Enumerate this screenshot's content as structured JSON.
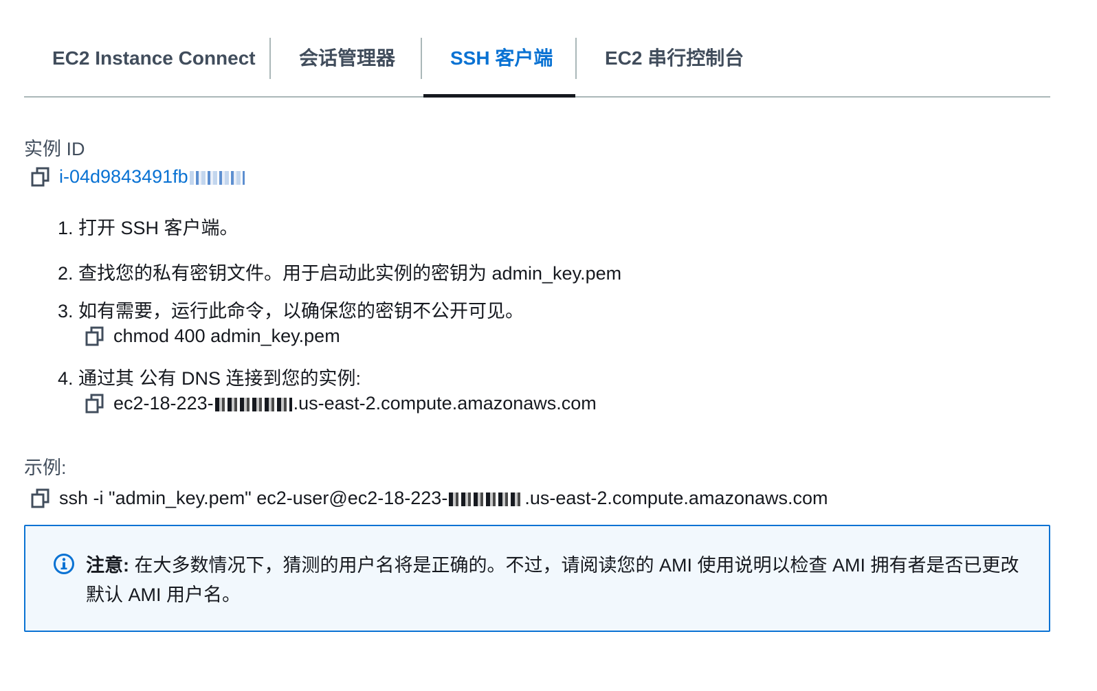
{
  "tabs": [
    {
      "label": "EC2 Instance Connect",
      "active": false
    },
    {
      "label": "会话管理器",
      "active": false
    },
    {
      "label": "SSH 客户端",
      "active": true
    },
    {
      "label": "EC2 串行控制台",
      "active": false
    }
  ],
  "instance": {
    "label": "实例 ID",
    "id_visible": "i-04d9843491fb"
  },
  "steps": [
    {
      "num": "1.",
      "text": "打开 SSH 客户端。"
    },
    {
      "num": "2.",
      "text": "查找您的私有密钥文件。用于启动此实例的密钥为 admin_key.pem"
    },
    {
      "num": "3.",
      "text": "如有需要，运行此命令，以确保您的密钥不公开可见。"
    },
    {
      "num": "4.",
      "text": "通过其 公有 DNS 连接到您的实例:"
    }
  ],
  "commands": {
    "chmod": "chmod 400 admin_key.pem",
    "dns_prefix": "ec2-18-223-",
    "dns_suffix": ".us-east-2.compute.amazonaws.com"
  },
  "example": {
    "label": "示例:",
    "prefix": "ssh -i \"admin_key.pem\" ec2-user@ec2-18-223-",
    "suffix": ".us-east-2.compute.amazonaws.com"
  },
  "notice": {
    "title": "注意:",
    "body": " 在大多数情况下，猜测的用户名将是正确的。不过，请阅读您的 AMI 使用说明以检查 AMI 拥有者是否已更改默认 AMI 用户名。"
  },
  "colors": {
    "accent": "#0972d3",
    "text": "#16191f",
    "muted": "#414d5c",
    "notice_bg": "#f2f8fd"
  },
  "icons": {
    "copy": "copy-icon",
    "info": "info-icon"
  }
}
